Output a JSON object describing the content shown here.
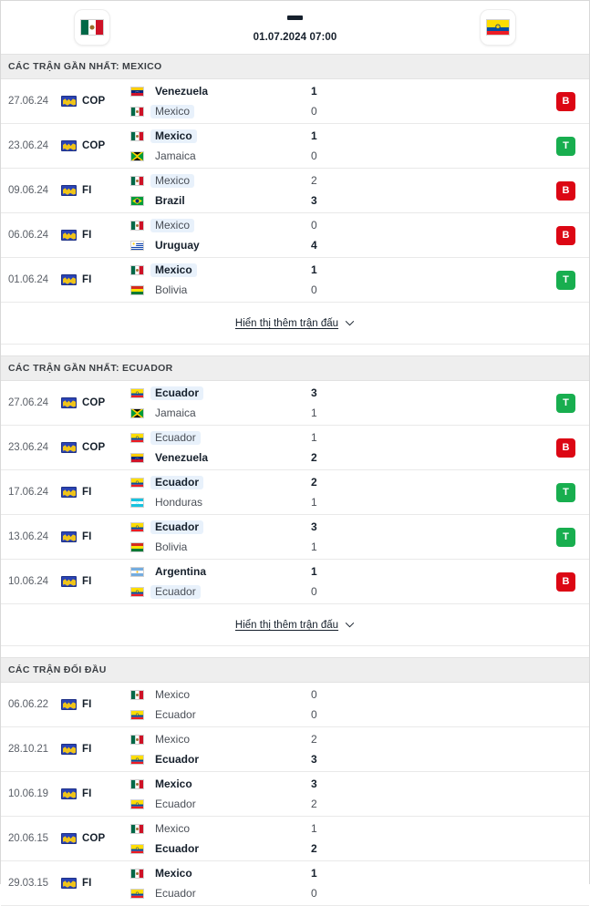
{
  "header": {
    "home_team": "Mexico",
    "away_team": "Ecuador",
    "score_placeholder": "-",
    "kickoff": "01.07.2024 07:00",
    "home_flag": "mexico-flag",
    "away_flag": "ecuador-flag"
  },
  "colors": {
    "win_badge": "#18ae4f",
    "loss_badge": "#dc0714",
    "highlight": "#e8f1fb",
    "section_bg": "#eeeeee"
  },
  "sections": [
    {
      "id": "mexico-form",
      "title": "CÁC TRẬN GẦN NHẤT: MEXICO",
      "has_result_badges": true,
      "show_more": "Hiển thị thêm trận đấu",
      "matches": [
        {
          "date": "27.06.24",
          "comp": "COP",
          "home": "Venezuela",
          "away": "Mexico",
          "home_score": "1",
          "away_score": "0",
          "home_win": true,
          "away_win": false,
          "home_hl": false,
          "away_hl": true,
          "result": "B",
          "result_type": "L",
          "home_flag": "venezuela-flag",
          "away_flag": "mexico-flag"
        },
        {
          "date": "23.06.24",
          "comp": "COP",
          "home": "Mexico",
          "away": "Jamaica",
          "home_score": "1",
          "away_score": "0",
          "home_win": true,
          "away_win": false,
          "home_hl": true,
          "away_hl": false,
          "result": "T",
          "result_type": "W",
          "home_flag": "mexico-flag",
          "away_flag": "jamaica-flag"
        },
        {
          "date": "09.06.24",
          "comp": "FI",
          "home": "Mexico",
          "away": "Brazil",
          "home_score": "2",
          "away_score": "3",
          "home_win": false,
          "away_win": true,
          "home_hl": true,
          "away_hl": false,
          "result": "B",
          "result_type": "L",
          "home_flag": "mexico-flag",
          "away_flag": "brazil-flag"
        },
        {
          "date": "06.06.24",
          "comp": "FI",
          "home": "Mexico",
          "away": "Uruguay",
          "home_score": "0",
          "away_score": "4",
          "home_win": false,
          "away_win": true,
          "home_hl": true,
          "away_hl": false,
          "result": "B",
          "result_type": "L",
          "home_flag": "mexico-flag",
          "away_flag": "uruguay-flag"
        },
        {
          "date": "01.06.24",
          "comp": "FI",
          "home": "Mexico",
          "away": "Bolivia",
          "home_score": "1",
          "away_score": "0",
          "home_win": true,
          "away_win": false,
          "home_hl": true,
          "away_hl": false,
          "result": "T",
          "result_type": "W",
          "home_flag": "mexico-flag",
          "away_flag": "bolivia-flag"
        }
      ]
    },
    {
      "id": "ecuador-form",
      "title": "CÁC TRẬN GẦN NHẤT: ECUADOR",
      "has_result_badges": true,
      "show_more": "Hiển thị thêm trận đấu",
      "matches": [
        {
          "date": "27.06.24",
          "comp": "COP",
          "home": "Ecuador",
          "away": "Jamaica",
          "home_score": "3",
          "away_score": "1",
          "home_win": true,
          "away_win": false,
          "home_hl": true,
          "away_hl": false,
          "result": "T",
          "result_type": "W",
          "home_flag": "ecuador-flag",
          "away_flag": "jamaica-flag"
        },
        {
          "date": "23.06.24",
          "comp": "COP",
          "home": "Ecuador",
          "away": "Venezuela",
          "home_score": "1",
          "away_score": "2",
          "home_win": false,
          "away_win": true,
          "home_hl": true,
          "away_hl": false,
          "result": "B",
          "result_type": "L",
          "home_flag": "ecuador-flag",
          "away_flag": "venezuela-flag"
        },
        {
          "date": "17.06.24",
          "comp": "FI",
          "home": "Ecuador",
          "away": "Honduras",
          "home_score": "2",
          "away_score": "1",
          "home_win": true,
          "away_win": false,
          "home_hl": true,
          "away_hl": false,
          "result": "T",
          "result_type": "W",
          "home_flag": "ecuador-flag",
          "away_flag": "honduras-flag"
        },
        {
          "date": "13.06.24",
          "comp": "FI",
          "home": "Ecuador",
          "away": "Bolivia",
          "home_score": "3",
          "away_score": "1",
          "home_win": true,
          "away_win": false,
          "home_hl": true,
          "away_hl": false,
          "result": "T",
          "result_type": "W",
          "home_flag": "ecuador-flag",
          "away_flag": "bolivia-flag"
        },
        {
          "date": "10.06.24",
          "comp": "FI",
          "home": "Argentina",
          "away": "Ecuador",
          "home_score": "1",
          "away_score": "0",
          "home_win": true,
          "away_win": false,
          "home_hl": false,
          "away_hl": true,
          "result": "B",
          "result_type": "L",
          "home_flag": "argentina-flag",
          "away_flag": "ecuador-flag"
        }
      ]
    },
    {
      "id": "head-to-head",
      "title": "CÁC TRẬN ĐỐI ĐẦU",
      "has_result_badges": false,
      "show_more": null,
      "matches": [
        {
          "date": "06.06.22",
          "comp": "FI",
          "home": "Mexico",
          "away": "Ecuador",
          "home_score": "0",
          "away_score": "0",
          "home_win": false,
          "away_win": false,
          "home_hl": false,
          "away_hl": false,
          "result": null,
          "result_type": null,
          "home_flag": "mexico-flag",
          "away_flag": "ecuador-flag"
        },
        {
          "date": "28.10.21",
          "comp": "FI",
          "home": "Mexico",
          "away": "Ecuador",
          "home_score": "2",
          "away_score": "3",
          "home_win": false,
          "away_win": true,
          "home_hl": false,
          "away_hl": false,
          "result": null,
          "result_type": null,
          "home_flag": "mexico-flag",
          "away_flag": "ecuador-flag"
        },
        {
          "date": "10.06.19",
          "comp": "FI",
          "home": "Mexico",
          "away": "Ecuador",
          "home_score": "3",
          "away_score": "2",
          "home_win": true,
          "away_win": false,
          "home_hl": false,
          "away_hl": false,
          "result": null,
          "result_type": null,
          "home_flag": "mexico-flag",
          "away_flag": "ecuador-flag"
        },
        {
          "date": "20.06.15",
          "comp": "COP",
          "home": "Mexico",
          "away": "Ecuador",
          "home_score": "1",
          "away_score": "2",
          "home_win": false,
          "away_win": true,
          "home_hl": false,
          "away_hl": false,
          "result": null,
          "result_type": null,
          "home_flag": "mexico-flag",
          "away_flag": "ecuador-flag"
        },
        {
          "date": "29.03.15",
          "comp": "FI",
          "home": "Mexico",
          "away": "Ecuador",
          "home_score": "1",
          "away_score": "0",
          "home_win": true,
          "away_win": false,
          "home_hl": false,
          "away_hl": false,
          "result": null,
          "result_type": null,
          "home_flag": "mexico-flag",
          "away_flag": "ecuador-flag"
        }
      ]
    }
  ]
}
